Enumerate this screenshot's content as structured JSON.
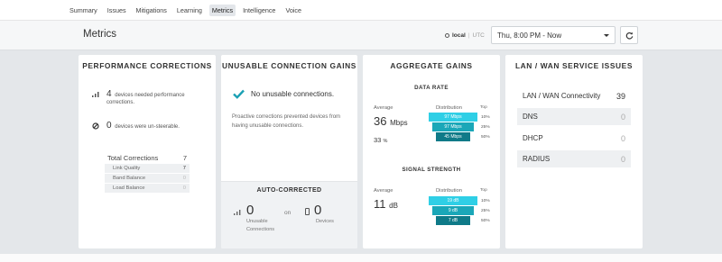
{
  "nav": {
    "tabs": [
      {
        "label": "Summary"
      },
      {
        "label": "Issues"
      },
      {
        "label": "Mitigations"
      },
      {
        "label": "Learning"
      },
      {
        "label": "Metrics"
      },
      {
        "label": "Intelligence"
      },
      {
        "label": "Voice"
      }
    ],
    "active_tab": "Metrics"
  },
  "header": {
    "title": "Metrics",
    "timezone_local": "local",
    "timezone_utc": "UTC",
    "time_range": "Thu, 8:00 PM - Now",
    "refresh_icon": "refresh-icon"
  },
  "performance": {
    "title": "PERFORMANCE CORRECTIONS",
    "needed_count": "4",
    "needed_text": "devices needed performance corrections.",
    "unsteerable_count": "0",
    "unsteerable_text": "devices were un-steerable.",
    "total_label": "Total Corrections",
    "total_value": "7",
    "rows": [
      {
        "label": "Link Quality",
        "value": "7"
      },
      {
        "label": "Band Balance",
        "value": "0"
      },
      {
        "label": "Load Balance",
        "value": "0"
      }
    ]
  },
  "unusable": {
    "title": "UNUSABLE CONNECTION GAINS",
    "status": "No unusable connections.",
    "description": "Proactive corrections prevented devices from having unusable connections.",
    "auto_title": "AUTO-CORRECTED",
    "connections_value": "0",
    "connections_label": "Unusable Connections",
    "on_label": "on",
    "devices_value": "0",
    "devices_label": "Devices"
  },
  "aggregate": {
    "title": "AGGREGATE GAINS",
    "data_rate": {
      "title": "DATA RATE",
      "average_label": "Average",
      "average_value": "36",
      "average_unit": "Mbps",
      "percent_value": "33",
      "percent_unit": "%",
      "distribution_label": "Distribution",
      "top_label": "Top",
      "tiers": [
        {
          "label": "97 Mbps",
          "top": "10%"
        },
        {
          "label": "97 Mbps",
          "top": "25%"
        },
        {
          "label": "45 Mbps",
          "top": "50%"
        }
      ]
    },
    "signal": {
      "title": "SIGNAL STRENGTH",
      "average_label": "Average",
      "average_value": "11",
      "average_unit": "dB",
      "distribution_label": "Distribution",
      "top_label": "Top",
      "tiers": [
        {
          "label": "19 dB",
          "top": "10%"
        },
        {
          "label": "9 dB",
          "top": "25%"
        },
        {
          "label": "7 dB",
          "top": "50%"
        }
      ]
    },
    "colors": {
      "tier1": "#2fcfe6",
      "tier2": "#1aa7b8",
      "tier3": "#0f7a88"
    }
  },
  "lanwan": {
    "title": "LAN / WAN SERVICE ISSUES",
    "rows": [
      {
        "label": "LAN / WAN Connectivity",
        "value": "39"
      },
      {
        "label": "DNS",
        "value": "0"
      },
      {
        "label": "DHCP",
        "value": "0"
      },
      {
        "label": "RADIUS",
        "value": "0"
      }
    ]
  }
}
